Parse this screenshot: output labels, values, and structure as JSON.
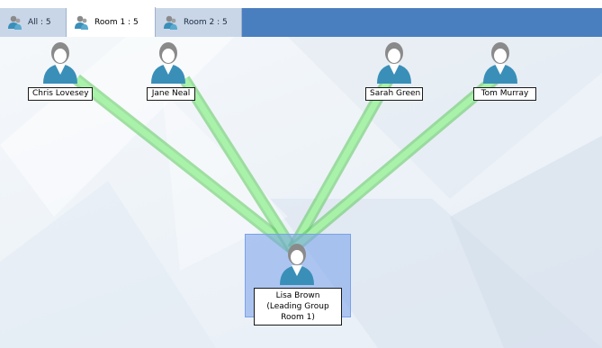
{
  "tabs": [
    {
      "label": "All : 5",
      "active": false
    },
    {
      "label": "Room 1 : 5",
      "active": true
    },
    {
      "label": "Room 2 : 5",
      "active": false
    }
  ],
  "members": [
    {
      "name": "Chris Lovesey"
    },
    {
      "name": "Jane Neal"
    },
    {
      "name": "Sarah Green"
    },
    {
      "name": "Tom Murray"
    }
  ],
  "leader": {
    "name": "Lisa Brown (Leading Group Room 1)"
  },
  "colors": {
    "tabbar": "#4a7fbf",
    "link": "#7fe27f",
    "selection": "#7aa2e8",
    "person_body": "#3a8fb8",
    "person_head": "#8a8a8a"
  },
  "icons": {
    "tab": "user-group-icon",
    "member": "user-avatar-icon"
  }
}
